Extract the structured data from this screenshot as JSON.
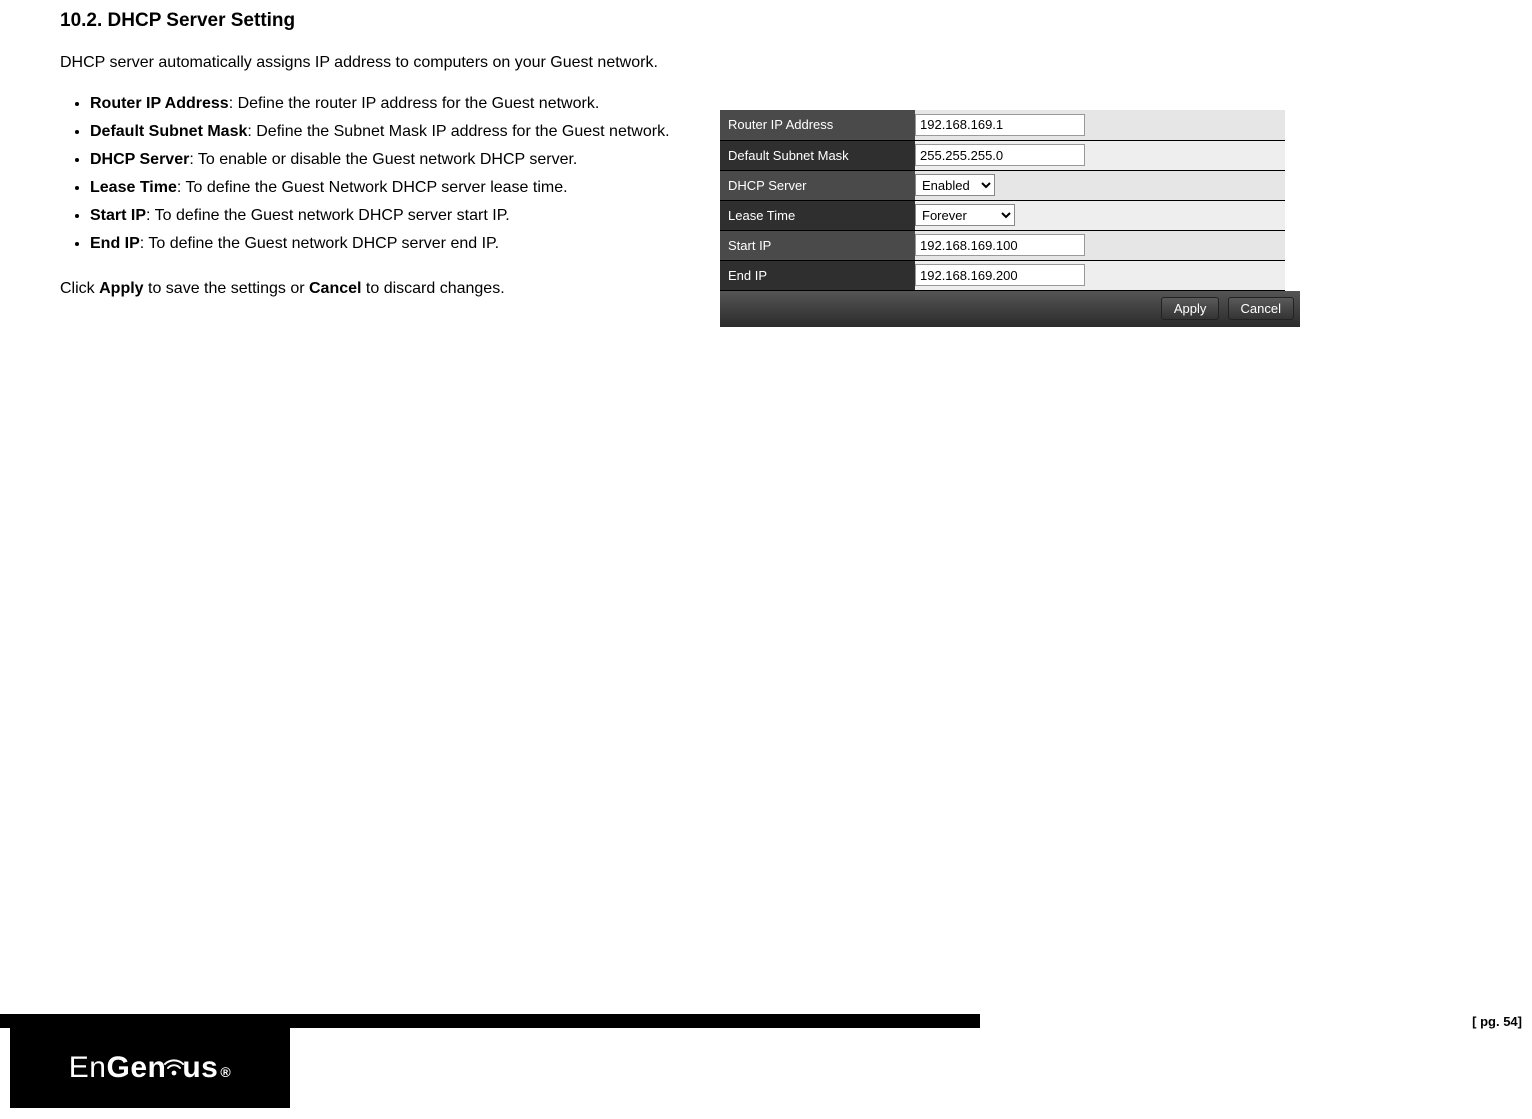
{
  "heading": "10.2.  DHCP Server Setting",
  "intro": "DHCP server automatically assigns IP address to computers on your Guest network.",
  "definitions": [
    {
      "term": "Router IP Address",
      "desc": ": Define the router IP address for the Guest network."
    },
    {
      "term": "Default Subnet Mask",
      "desc": ": Define the Subnet Mask IP address for the Guest network."
    },
    {
      "term": "DHCP Server",
      "desc": ": To enable or disable the Guest network DHCP server."
    },
    {
      "term": "Lease Time",
      "desc": ": To define the Guest Network DHCP server lease time."
    },
    {
      "term": "Start IP",
      "desc": ": To define the Guest network DHCP server start IP."
    },
    {
      "term": "End IP",
      "desc": ": To define the Guest network DHCP server end IP."
    }
  ],
  "actions": {
    "prefix": "Click ",
    "apply": "Apply",
    "mid": " to save the settings or ",
    "cancel": "Cancel",
    "suffix": " to discard changes."
  },
  "panel": {
    "rows": {
      "router_ip": {
        "label": "Router IP Address",
        "value": "192.168.169.1"
      },
      "subnet": {
        "label": "Default Subnet Mask",
        "value": "255.255.255.0"
      },
      "dhcp": {
        "label": "DHCP Server",
        "value": "Enabled"
      },
      "lease": {
        "label": "Lease Time",
        "value": "Forever"
      },
      "start_ip": {
        "label": "Start IP",
        "value": "192.168.169.100"
      },
      "end_ip": {
        "label": "End IP",
        "value": "192.168.169.200"
      }
    },
    "buttons": {
      "apply": "Apply",
      "cancel": "Cancel"
    }
  },
  "footer": {
    "logo": "EnGenius",
    "page": "[ pg. 54]"
  }
}
